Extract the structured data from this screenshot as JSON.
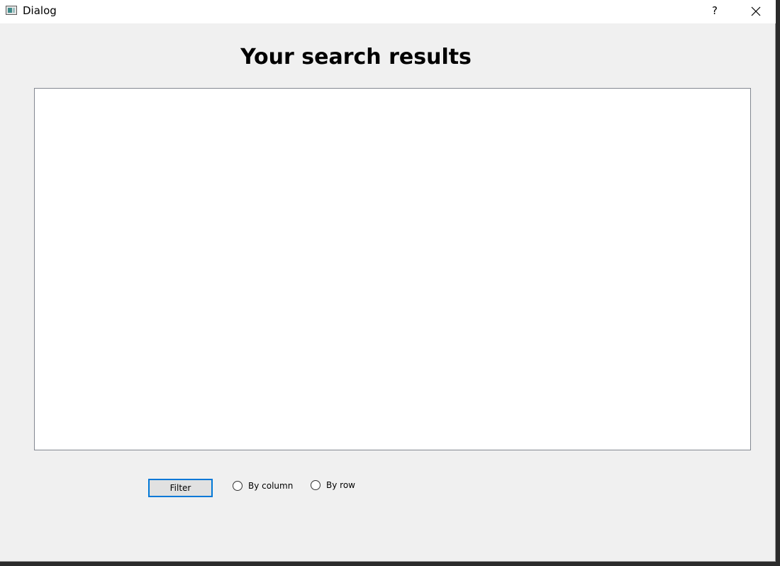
{
  "window": {
    "title": "Dialog",
    "help_label": "?",
    "close_icon": "close-icon",
    "app_icon": "dialog-app-icon"
  },
  "main": {
    "heading": "Your search results",
    "results_area_content": ""
  },
  "controls": {
    "filter_label": "Filter",
    "radio_by_column": {
      "label": "By column",
      "checked": false
    },
    "radio_by_row": {
      "label": "By row",
      "checked": false
    }
  },
  "colors": {
    "focus_accent": "#0078d7",
    "window_bg": "#f0f0f0",
    "titlebar_bg": "#ffffff"
  }
}
